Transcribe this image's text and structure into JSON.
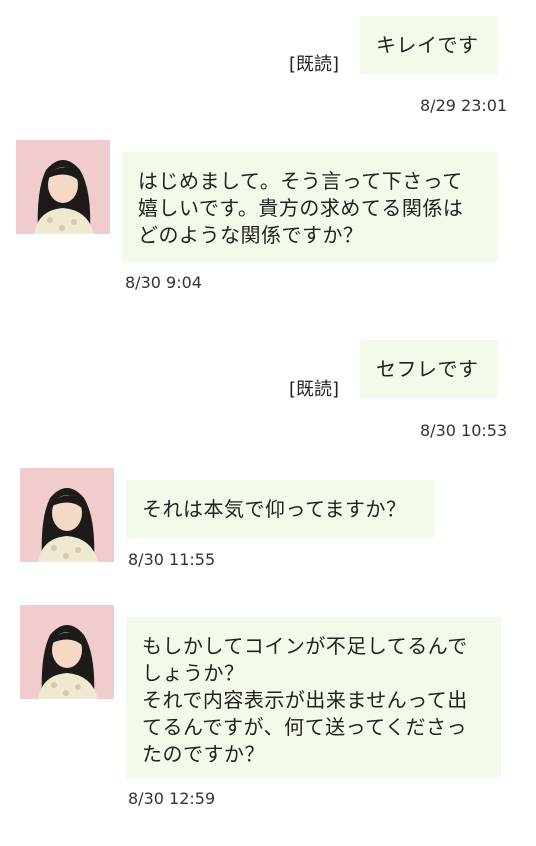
{
  "colors": {
    "bubble_bg": "#f2fbe9",
    "text": "#222222",
    "avatar_bg": "#f3d4d6"
  },
  "messages": [
    {
      "sender": "self",
      "text": "キレイです",
      "read_label": "[既読]",
      "time": "8/29 23:01"
    },
    {
      "sender": "partner",
      "avatar_icon": "profile-photo-woman",
      "text": "はじめまして。そう言って下さって\n嬉しいです。貴方の求めてる関係は\nどのような関係ですか？",
      "time": "8/30 9:04"
    },
    {
      "sender": "self",
      "text": "セフレです",
      "read_label": "[既読]",
      "time": "8/30 10:53"
    },
    {
      "sender": "partner",
      "avatar_icon": "profile-photo-woman",
      "text": "それは本気で仰ってますか？",
      "time": "8/30 11:55"
    },
    {
      "sender": "partner",
      "avatar_icon": "profile-photo-woman",
      "text": "もしかしてコインが不足してるんで\nしょうか？\nそれで内容表示が出来ませんって出\nてるんですが、何て送ってくださっ\nたのですか？",
      "time": "8/30 12:59"
    }
  ]
}
